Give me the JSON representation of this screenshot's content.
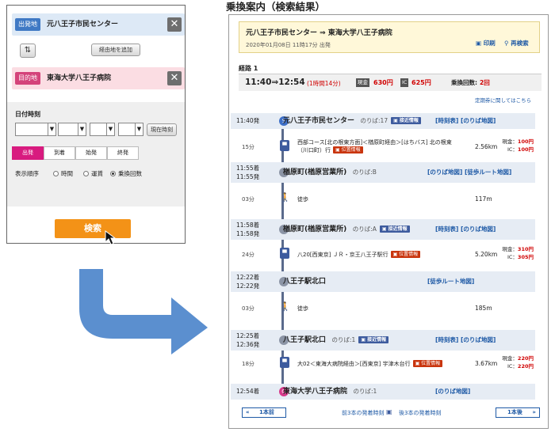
{
  "form": {
    "origin_tag": "出発地",
    "origin_name": "元八王子市民センター",
    "swap_icon": "⇅",
    "waypoint_button": "経由地を追加",
    "dest_tag": "目的地",
    "dest_name": "東海大学八王子病院",
    "close_glyph": "✕",
    "datetime_label": "日付時刻",
    "now_button": "現在時刻",
    "modes": [
      "出発",
      "到着",
      "始発",
      "終発"
    ],
    "sort_label": "表示順序",
    "sort_options": [
      "時間",
      "運賃",
      "乗換回数"
    ],
    "sort_selected": "乗換回数",
    "search_button": "検索"
  },
  "result": {
    "page_title": "乗換案内（検索結果）",
    "route_title": "元八王子市民センター ⇒ 東海大学八王子病院",
    "route_date": "2020年01月08日 11時17分 出発",
    "print": "印刷",
    "research": "再検索",
    "route_label": "経路 1",
    "time_summary": "11:40⇒12:54",
    "duration": "(1時間14分)",
    "fare_badge": "現金",
    "fare_cash": "630円",
    "ic_badge": "IC",
    "fare_ic": "625円",
    "transfers_label": "乗換回数:",
    "transfers": "2回",
    "pass_link": "定期券に関してはこちら",
    "stops": [
      {
        "times": [
          "11:40発"
        ],
        "name": "元八王子市民センター",
        "platform": "のりば:17",
        "badge": "接近情報",
        "links": "[時刻表] [のりば地図]"
      },
      {
        "times": [
          "11:55着",
          "11:55発"
        ],
        "name": "楢原町(楢原営業所)",
        "platform": "のりば:B",
        "badge": "",
        "links": "[のりば地図] [徒歩ルート地図]"
      },
      {
        "times": [
          "11:58着",
          "11:58発"
        ],
        "name": "楢原町(楢原営業所)",
        "platform": "のりば:A",
        "badge": "接近情報",
        "links": "[時刻表] [のりば地図]"
      },
      {
        "times": [
          "12:22着",
          "12:22発"
        ],
        "name": "八王子駅北口",
        "platform": "",
        "badge": "",
        "links": "[徒歩ルート地図]"
      },
      {
        "times": [
          "12:25着",
          "12:36発"
        ],
        "name": "八王子駅北口",
        "platform": "のりば:1",
        "badge": "接近情報",
        "links": "[時刻表] [のりば地図]"
      },
      {
        "times": [
          "12:54着"
        ],
        "name": "東海大学八王子病院",
        "platform": "のりば:1",
        "badge": "",
        "links": "[のりば地図]"
      }
    ],
    "legs": [
      {
        "dur": "15分",
        "line": "西部コース[北の根東方面]＜楢原町経由＞[はちバス] 北の根東（川口町）行",
        "badge": "位置情報",
        "dist": "2.56km",
        "cash": "100円",
        "ic": "100円"
      },
      {
        "dur": "03分",
        "line": "徒歩",
        "badge": "",
        "dist": "117m",
        "cash": "",
        "ic": ""
      },
      {
        "dur": "24分",
        "line": "八20[西東京] ＪＲ・京王八王子駅行",
        "badge": "位置情報",
        "dist": "5.20km",
        "cash": "310円",
        "ic": "305円"
      },
      {
        "dur": "03分",
        "line": "徒歩",
        "badge": "",
        "dist": "185m",
        "cash": "",
        "ic": ""
      },
      {
        "dur": "18分",
        "line": "大02＜東海大病院経由＞[西東京] 宇津木台行",
        "badge": "位置情報",
        "dist": "3.67km",
        "cash": "220円",
        "ic": "220円"
      }
    ],
    "cash_label": "現金：",
    "ic_label": "IC：",
    "prev_button": "1本前",
    "prev3": "前3本の発着時刻",
    "next3": "後3本の発着時刻",
    "next_button": "1本後"
  },
  "colors": {
    "origin_bg": "#dde9f6",
    "origin_tag": "#3f79c4",
    "dest_bg": "#fbdde3",
    "dest_tag": "#d4437a",
    "search_btn": "#f39217",
    "mode_on": "#d81b7f",
    "flow_arrow": "#5b8fcf",
    "link": "#1f5aa6",
    "price": "#d00000"
  }
}
